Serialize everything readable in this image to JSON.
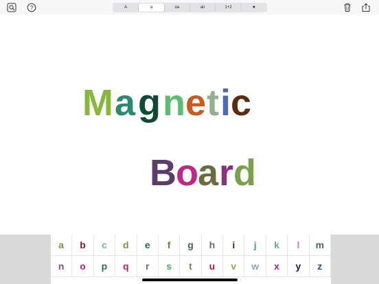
{
  "toolbar": {
    "tabs": [
      "A",
      "a",
      "oa",
      "air",
      "1+2",
      "★"
    ],
    "active_tab": "a"
  },
  "icons": [
    "magnifier-icon",
    "help-icon",
    "trash-icon",
    "share-icon"
  ],
  "board": {
    "word1": [
      {
        "char": "M",
        "color": "#86b83a"
      },
      {
        "char": "a",
        "color": "#2a8a72"
      },
      {
        "char": "g",
        "color": "#0f4b32"
      },
      {
        "char": "n",
        "color": "#57bf6e"
      },
      {
        "char": "e",
        "color": "#cc5a1c"
      },
      {
        "char": "t",
        "color": "#93b08f"
      },
      {
        "char": "i",
        "color": "#4c6bb5"
      },
      {
        "char": "c",
        "color": "#5a2c10"
      }
    ],
    "word2": [
      {
        "char": "B",
        "color": "#5b3c6c"
      },
      {
        "char": "o",
        "color": "#c2268a"
      },
      {
        "char": "a",
        "color": "#6a6e3e"
      },
      {
        "char": "r",
        "color": "#8c2f7d"
      },
      {
        "char": "d",
        "color": "#78a24a"
      }
    ]
  },
  "keyboard": {
    "row1": [
      {
        "char": "a",
        "color": "#7f8a36"
      },
      {
        "char": "b",
        "color": "#7a1d1d"
      },
      {
        "char": "c",
        "color": "#6fb6b6"
      },
      {
        "char": "d",
        "color": "#6f9a4a"
      },
      {
        "char": "e",
        "color": "#1f6a52"
      },
      {
        "char": "f",
        "color": "#7a7a3a"
      },
      {
        "char": "g",
        "color": "#3a6a5a"
      },
      {
        "char": "h",
        "color": "#6a6a6a"
      },
      {
        "char": "i",
        "color": "#2a2a6a"
      },
      {
        "char": "j",
        "color": "#3aa6a6"
      },
      {
        "char": "k",
        "color": "#6aa6a0"
      },
      {
        "char": "l",
        "color": "#c67ad6"
      },
      {
        "char": "m",
        "color": "#4a6a6a"
      }
    ],
    "row2": [
      {
        "char": "n",
        "color": "#8a4a8a"
      },
      {
        "char": "o",
        "color": "#c21a8a"
      },
      {
        "char": "p",
        "color": "#2a6a6a"
      },
      {
        "char": "q",
        "color": "#c21a6a"
      },
      {
        "char": "r",
        "color": "#6a6a8a"
      },
      {
        "char": "s",
        "color": "#3ab65a"
      },
      {
        "char": "t",
        "color": "#8a7a4a"
      },
      {
        "char": "u",
        "color": "#aa1a2a"
      },
      {
        "char": "v",
        "color": "#9aa64a"
      },
      {
        "char": "w",
        "color": "#8aa6c6"
      },
      {
        "char": "x",
        "color": "#a61aa6"
      },
      {
        "char": "y",
        "color": "#1a1a5a"
      },
      {
        "char": "z",
        "color": "#2a4a9a"
      }
    ]
  }
}
